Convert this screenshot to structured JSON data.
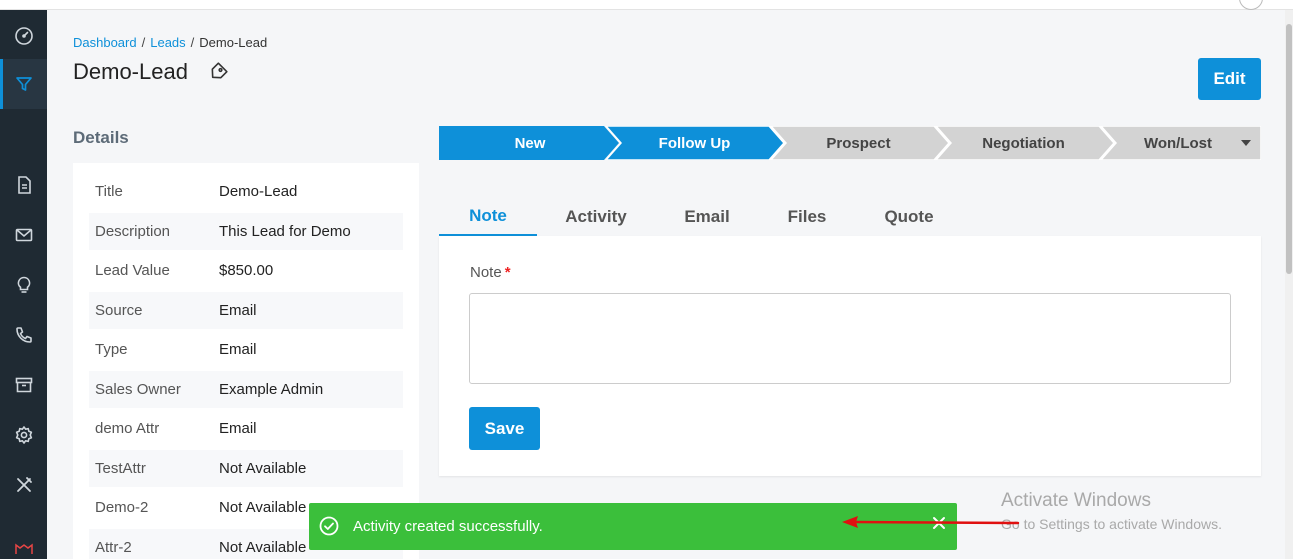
{
  "breadcrumb": {
    "dashboard": "Dashboard",
    "leads": "Leads",
    "current": "Demo-Lead",
    "sep": "/"
  },
  "page": {
    "title": "Demo-Lead",
    "edit_label": "Edit"
  },
  "details": {
    "heading": "Details",
    "rows": [
      {
        "label": "Title",
        "value": "Demo-Lead"
      },
      {
        "label": "Description",
        "value": "This Lead for Demo"
      },
      {
        "label": "Lead Value",
        "value": "$850.00"
      },
      {
        "label": "Source",
        "value": "Email"
      },
      {
        "label": "Type",
        "value": "Email"
      },
      {
        "label": "Sales Owner",
        "value": "Example Admin"
      },
      {
        "label": "demo Attr",
        "value": "Email"
      },
      {
        "label": "TestAttr",
        "value": "Not Available"
      },
      {
        "label": "Demo-2",
        "value": "Not Available"
      },
      {
        "label": "Attr-2",
        "value": "Not Available"
      }
    ]
  },
  "stages": [
    {
      "label": "New",
      "state": "done"
    },
    {
      "label": "Follow Up",
      "state": "current"
    },
    {
      "label": "Prospect",
      "state": "pending"
    },
    {
      "label": "Negotiation",
      "state": "pending"
    },
    {
      "label": "Won/Lost",
      "state": "pending"
    }
  ],
  "tabs": [
    {
      "label": "Note",
      "active": true
    },
    {
      "label": "Activity",
      "active": false
    },
    {
      "label": "Email",
      "active": false
    },
    {
      "label": "Files",
      "active": false
    },
    {
      "label": "Quote",
      "active": false
    }
  ],
  "note_form": {
    "label": "Note",
    "required_mark": "*",
    "value": "",
    "save_label": "Save"
  },
  "toast": {
    "message": "Activity created successfully."
  },
  "watermark": {
    "line1": "Activate Windows",
    "line2": "Go to Settings to activate Windows."
  },
  "sidebar": {
    "items": [
      {
        "icon": "dashboard-gauge-icon"
      },
      {
        "icon": "funnel-icon",
        "active": true
      },
      {
        "icon": "quote-document-icon"
      },
      {
        "icon": "mail-icon"
      },
      {
        "icon": "lightbulb-icon"
      },
      {
        "icon": "phone-icon"
      },
      {
        "icon": "archive-icon"
      },
      {
        "icon": "settings-gear-icon"
      },
      {
        "icon": "tools-icon"
      },
      {
        "icon": "app-logo-icon"
      }
    ]
  },
  "colors": {
    "primary": "#0e90d9",
    "sidebar": "#1f2a33",
    "success": "#3bbf3b",
    "stage_pending": "#d3d3d3",
    "annotation_arrow": "#e01010"
  }
}
